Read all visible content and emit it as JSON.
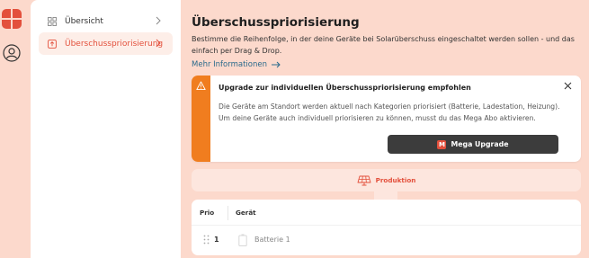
{
  "nav": {
    "items": [
      {
        "label": "Übersicht",
        "icon": "grid-icon",
        "active": false
      },
      {
        "label": "Überschusspriorisierung",
        "icon": "priority-icon",
        "active": true
      }
    ]
  },
  "page": {
    "title": "Überschusspriorisierung",
    "description": "Bestimme die Reihenfolge, in der deine Geräte bei Solarüberschuss eingeschaltet werden sollen - und das einfach per Drag & Drop.",
    "more_link": "Mehr Informationen"
  },
  "alert": {
    "title": "Upgrade zur individuellen Überschusspriorisierung empfohlen",
    "body": "Die Geräte am Standort werden aktuell nach Kategorien priorisiert (Batterie, Ladestation, Heizung). Um deine Geräte auch individuell priorisieren zu können, musst du das Mega Abo aktivieren.",
    "button_label": "Mega Upgrade",
    "button_badge": "M"
  },
  "production": {
    "label": "Produktion"
  },
  "table": {
    "headers": {
      "prio": "Prio",
      "device": "Gerät"
    },
    "rows": [
      {
        "prio": "1",
        "device": "Batterie 1",
        "icon": "battery-icon"
      }
    ]
  },
  "colors": {
    "background": "#fcd9cc",
    "accent": "#e3503c",
    "warning": "#f07d1f",
    "button_dark": "#3c3c3c",
    "link": "#2a6a8c"
  }
}
